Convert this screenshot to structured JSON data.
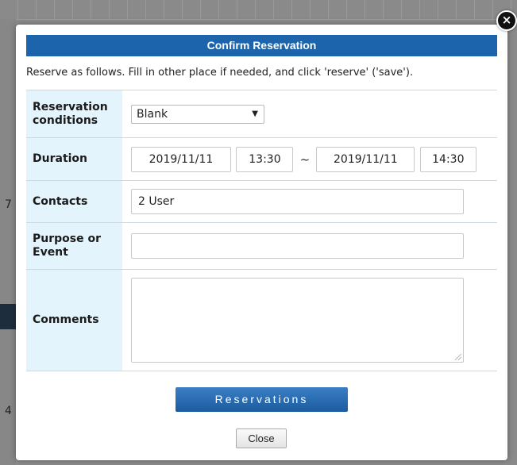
{
  "backdrop": {
    "numbers": [
      "7",
      "4"
    ]
  },
  "dialog": {
    "title": "Confirm Reservation",
    "instructions": "Reserve as follows. Fill in other place if needed, and click 'reserve' ('save').",
    "close_icon": "×"
  },
  "form": {
    "conditions": {
      "label": "Reservation conditions",
      "value": "Blank",
      "caret": "▼"
    },
    "duration": {
      "label": "Duration",
      "start_date": "2019/11/11",
      "start_time": "13:30",
      "separator": "~",
      "end_date": "2019/11/11",
      "end_time": "14:30"
    },
    "contacts": {
      "label": "Contacts",
      "value": "2 User"
    },
    "purpose": {
      "label": "Purpose or Event",
      "value": ""
    },
    "comments": {
      "label": "Comments",
      "value": ""
    }
  },
  "actions": {
    "reserve_label": "Reservations",
    "close_label": "Close"
  },
  "colors": {
    "title_bar": "#1c65ad",
    "label_bg": "#e4f4fc",
    "reserve_button": "#1f63a8"
  }
}
